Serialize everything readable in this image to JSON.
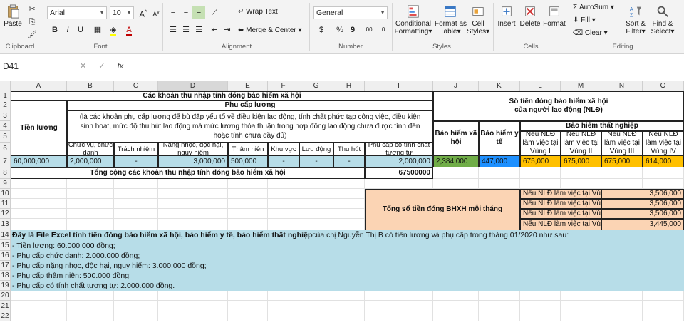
{
  "ribbon": {
    "clipboard": {
      "paste": "Paste",
      "group": "Clipboard"
    },
    "font": {
      "name": "Arial",
      "size": "10",
      "grow": "A",
      "shrink": "A",
      "bold": "B",
      "italic": "I",
      "underline": "U",
      "font_color_letter": "A",
      "group": "Font"
    },
    "alignment": {
      "wrap": "Wrap Text",
      "merge": "Merge & Center",
      "group": "Alignment"
    },
    "number": {
      "format": "General",
      "currency": "$",
      "percent": "%",
      "comma": "9",
      "group": "Number"
    },
    "styles": {
      "conditional": "Conditional",
      "conditional2": "Formatting",
      "format_table": "Format as",
      "format_table2": "Table",
      "cell_styles": "Cell",
      "cell_styles2": "Styles",
      "group": "Styles"
    },
    "cells": {
      "insert": "Insert",
      "delete": "Delete",
      "format": "Format",
      "group": "Cells"
    },
    "editing": {
      "autosum": "AutoSum",
      "fill": "Fill",
      "clear": "Clear",
      "sort": "Sort &",
      "sort2": "Filter",
      "find": "Find &",
      "find2": "Select",
      "group": "Editing"
    }
  },
  "formula_bar": {
    "name_box": "D41",
    "fx": "fx",
    "content": ""
  },
  "columns": [
    "A",
    "B",
    "C",
    "D",
    "E",
    "F",
    "G",
    "H",
    "I",
    "J",
    "K",
    "L",
    "M",
    "N",
    "O"
  ],
  "rows": [
    "1",
    "2",
    "3",
    "4",
    "5",
    "6",
    "7",
    "8",
    "9",
    "10",
    "11",
    "12",
    "13",
    "14",
    "15",
    "16",
    "17",
    "18",
    "19",
    "20",
    "21",
    "22"
  ],
  "sheet": {
    "title": "Các khoản thu nhập tính đóng bảo hiểm xã hội",
    "right_title_1": "Số tiền đóng bảo hiểm xã hội",
    "right_title_2": "của người lao động (NLĐ)",
    "salary_header": "Tiền lương",
    "allowance_header": "Phụ cấp lương",
    "allowance_desc": "(là các khoản phụ cấp lương để bù đắp yếu tố về điều kiện lao động, tính chất phức tạp công việc, điều kiện sinh hoạt, mức độ thu hút lao động mà mức lương thỏa thuận trong hợp đồng lao động chưa được tính đến hoặc tính chưa đầy đủ)",
    "bhxh_header": "Bảo hiểm xã hội",
    "bhyt_header": "Bảo hiểm y tế",
    "bhtn_header": "Bảo hiểm thất nghiệp",
    "sub_headers": [
      "Chức vụ, chức danh",
      "Trách nhiệm",
      "Nặng nhọc, độc hại, nguy hiểm",
      "Thâm niên",
      "Khu vực",
      "Lưu động",
      "Thu hút",
      "Phụ cấp có tính chất tương tự"
    ],
    "region_headers": [
      "Nếu NLĐ làm việc tại Vùng I",
      "Nếu NLĐ làm việc tại Vùng II",
      "Nếu NLĐ làm việc tại Vùng III",
      "Nếu NLĐ làm việc tại Vùng IV"
    ],
    "row7": [
      "60,000,000",
      "2,000,000",
      "-",
      "3,000,000",
      "500,000",
      "-",
      "-",
      "-",
      "2,000,000",
      "2,384,000",
      "447,000",
      "675,000",
      "675,000",
      "675,000",
      "614,000"
    ],
    "total_label": "Tổng cộng các khoản thu nhập tính đóng bảo hiểm xã hội",
    "total_value": "67500000",
    "summary_label": "Tổng số tiền đóng BHXH mỗi tháng",
    "summary_rows": [
      {
        "label": "Nếu NLĐ làm việc tại Vùng I",
        "value": "3,506,000"
      },
      {
        "label": "Nếu NLĐ làm việc tại Vùng II",
        "value": "3,506,000"
      },
      {
        "label": "Nếu NLĐ làm việc tại Vùng III",
        "value": "3,506,000"
      },
      {
        "label": "Nếu NLĐ làm việc tại Vùng IV",
        "value": "3,445,000"
      }
    ],
    "note_bold": "Đây là File Excel tính tiền đóng bảo hiểm xã hội, bảo hiểm y tế, bảo hiểm thất nghiệp",
    "note_rest": " của chị Nguyễn Thị B có tiền lương và phụ cấp trong tháng 01/2020 như sau:",
    "note_lines": [
      "- Tiền lương: 60.000.000 đồng;",
      "- Phụ cấp chức danh: 2.000.000 đồng;",
      "- Phụ cấp nặng nhọc, độc hại, nguy hiểm: 3.000.000 đồng;",
      "- Phụ cấp thâm niên: 500.000 đồng;",
      "- Phụ cấp có tính chất tương tự: 2.000.000 đồng."
    ]
  },
  "colors": {
    "blue_band": "#b7dde8",
    "salmon": "#fbd4b4",
    "green": "#70ad47",
    "blue": "#1e90ff",
    "orange": "#ffc000"
  }
}
